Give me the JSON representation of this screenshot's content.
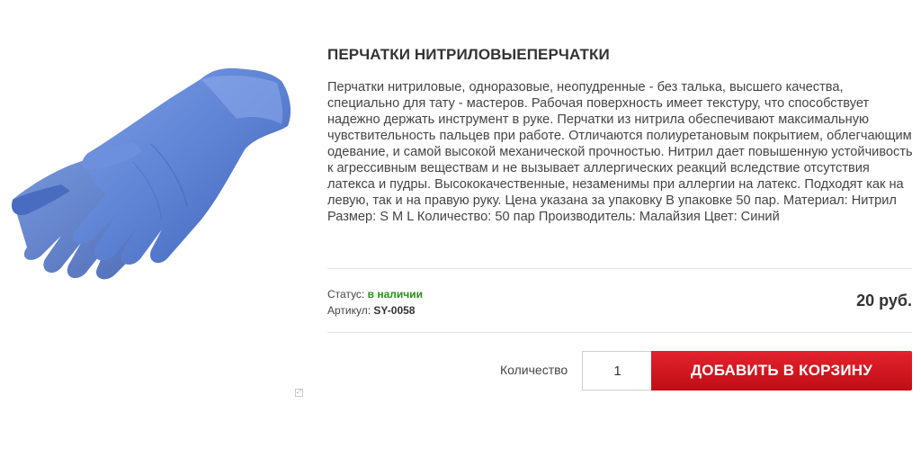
{
  "product": {
    "title": "ПЕРЧАТКИ НИТРИЛОВЫЕПЕРЧАТКИ",
    "description": "Перчатки нитриловые, одноразовые, неопудренные - без талька, высшего качества, специально для тату - мастеров. Рабочая поверхность имеет текстуру, что способствует надежно держать инструмент в руке. Перчатки из нитрила обеспечивают максимальную чувствительность пальцев при работе. Отличаются полиуретановым покрытием, облегчающим одевание, и самой высокой механической прочностью. Нитрил дает повышенную устойчивость к агрессивным веществам и не вызывает аллергических реакций вследствие отсутствия латекса и пудры. Высококачественные, незаменимы при аллергии на латекс. Подходят как на левую, так и на правую руку. Цена указана за упаковку В упаковке 50 пар. Материал: Нитрил Размер: S M L Количество: 50 пар Производитель: Малайзия Цвет: Синий",
    "image_icon": "blue-nitrile-gloves-image"
  },
  "status": {
    "label": "Статус:",
    "value": "в наличии"
  },
  "sku": {
    "label": "Артикул:",
    "value": "SY-0058"
  },
  "price": "20 руб.",
  "quantity": {
    "label": "Количество",
    "value": "1"
  },
  "cart_button_label": "ДОБАВИТЬ В КОРЗИНУ",
  "colors": {
    "status_in_stock": "#2a8f1a",
    "cart_button": "#d8151f",
    "glove_blue": "#5d83d4"
  }
}
